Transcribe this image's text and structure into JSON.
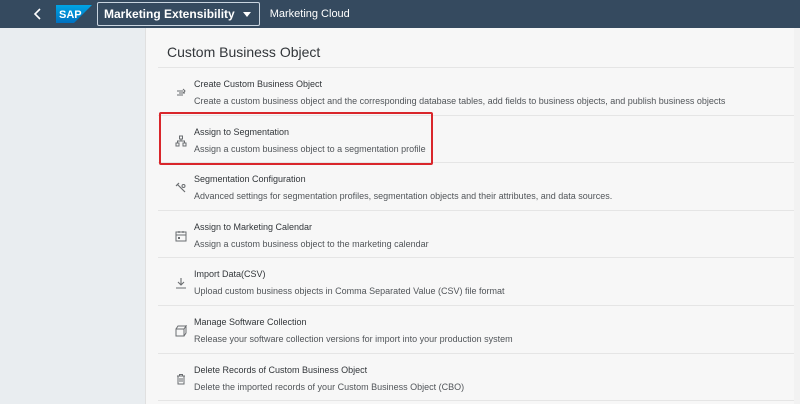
{
  "shell": {
    "logo_text": "SAP",
    "app_title": "Marketing Extensibility",
    "app_subtitle": "Marketing Cloud"
  },
  "panel": {
    "title": "Custom Business Object",
    "items": [
      {
        "title": "Create Custom Business Object",
        "desc": "Create a custom business object and the corresponding database tables, add fields to business objects, and publish business objects",
        "icon": "create-object-icon"
      },
      {
        "title": "Assign to Segmentation",
        "desc": "Assign a custom business object to a segmentation profile",
        "icon": "hierarchy-icon"
      },
      {
        "title": "Segmentation Configuration",
        "desc": "Advanced settings for segmentation profiles, segmentation objects and their attributes, and data sources.",
        "icon": "settings-icon"
      },
      {
        "title": "Assign to Marketing Calendar",
        "desc": "Assign a custom business object to the marketing calendar",
        "icon": "calendar-icon"
      },
      {
        "title": "Import Data(CSV)",
        "desc": "Upload custom business objects in Comma Separated Value (CSV) file format",
        "icon": "download-icon"
      },
      {
        "title": "Manage Software Collection",
        "desc": "Release your software collection versions for import into your production system",
        "icon": "package-icon"
      },
      {
        "title": "Delete Records of Custom Business Object",
        "desc": "Delete the imported records of your Custom Business Object (CBO)",
        "icon": "trash-icon"
      }
    ]
  },
  "colors": {
    "shell_bg": "#354a5f",
    "highlight": "#d9262b"
  }
}
